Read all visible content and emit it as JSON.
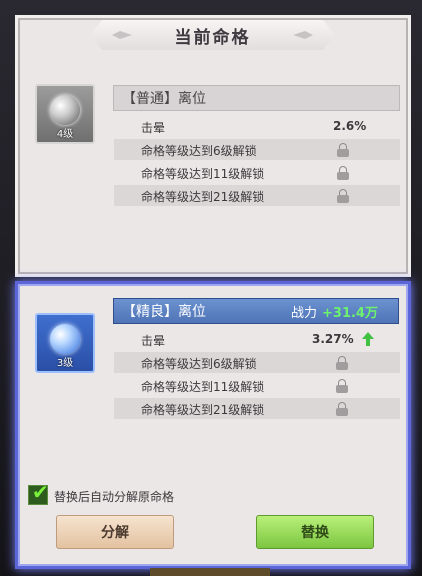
{
  "current": {
    "title": "当前命格",
    "level": "4级",
    "name": "【普通】离位",
    "stats": [
      {
        "label": "击晕",
        "value": "2.6%"
      },
      {
        "label": "命格等级达到6级解锁",
        "icon": "lock-icon"
      },
      {
        "label": "命格等级达到11级解锁",
        "icon": "lock-icon"
      },
      {
        "label": "命格等级达到21级解锁",
        "icon": "lock-icon"
      }
    ]
  },
  "candidate": {
    "level": "3级",
    "name": "【精良】离位",
    "power_label": "战力",
    "power_delta": "+31.4万",
    "stats": [
      {
        "label": "击晕",
        "value": "3.27%",
        "icon": "arrow-up-icon"
      },
      {
        "label": "命格等级达到6级解锁",
        "icon": "lock-icon"
      },
      {
        "label": "命格等级达到11级解锁",
        "icon": "lock-icon"
      },
      {
        "label": "命格等级达到21级解锁",
        "icon": "lock-icon"
      }
    ]
  },
  "controls": {
    "auto_decompose_checked": true,
    "auto_decompose_label": "替换后自动分解原命格",
    "decompose_button": "分解",
    "replace_button": "替换"
  },
  "colors": {
    "power_delta": "#6df26d",
    "replace_button": "#7dc640",
    "decompose_button": "#e3c2a1",
    "candidate_highlight": "#5c66d8"
  }
}
